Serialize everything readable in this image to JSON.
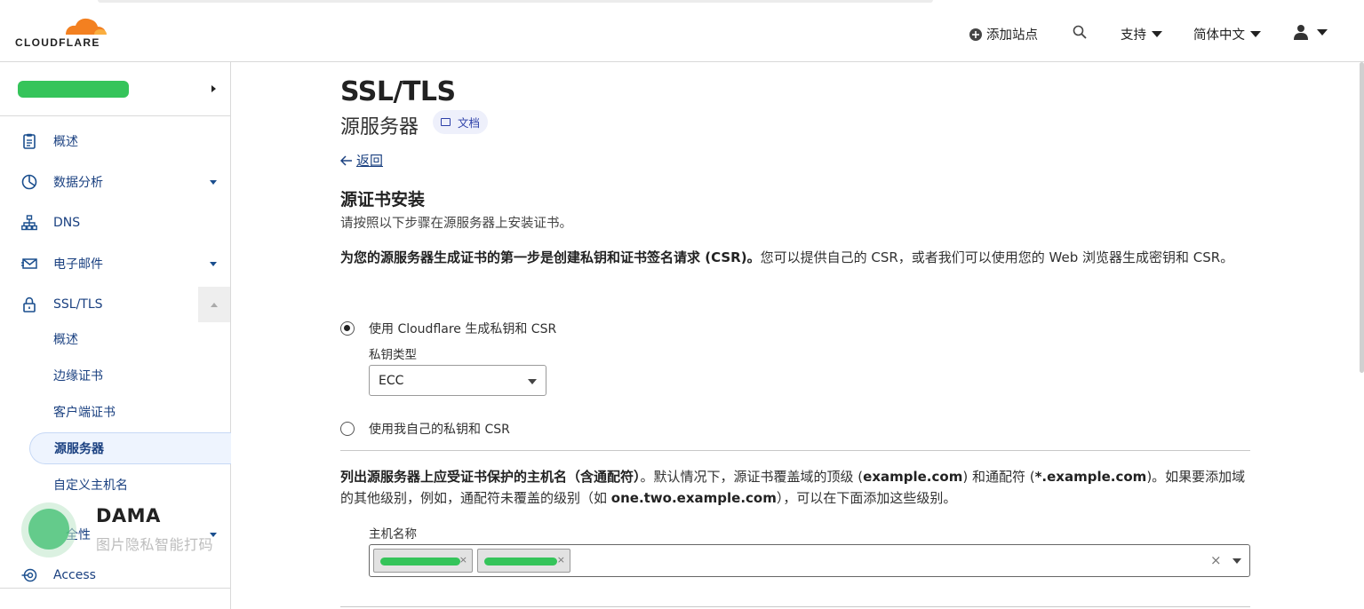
{
  "brand": {
    "wordmark": "CLOUDFLARE",
    "accent": "#f38020"
  },
  "topnav": {
    "add_site": "添加站点",
    "support": "支持",
    "language": "简体中文"
  },
  "sidebar": {
    "items": [
      {
        "label": "概述",
        "icon": "clipboard-icon"
      },
      {
        "label": "数据分析",
        "icon": "pie-chart-icon"
      },
      {
        "label": "DNS",
        "icon": "network-icon"
      },
      {
        "label": "电子邮件",
        "icon": "envelope-icon"
      },
      {
        "label": "SSL/TLS",
        "icon": "lock-icon"
      },
      {
        "label": "Access",
        "icon": "access-icon"
      }
    ],
    "ssl_sub": [
      {
        "label": "概述"
      },
      {
        "label": "边缘证书"
      },
      {
        "label": "客户端证书"
      },
      {
        "label": "源服务器"
      },
      {
        "label": "自定义主机名"
      }
    ],
    "partial_item": "全性"
  },
  "watermark": {
    "title": "DAMA",
    "subtitle": "图片隐私智能打码"
  },
  "page": {
    "title": "SSL/TLS",
    "subtitle": "源服务器",
    "docs": "文档",
    "back": "返回",
    "section_title": "源证书安装",
    "section_sub": "请按照以下步骤在源服务器上安装证书。",
    "csr_bold": "为您的源服务器生成证书的第一步是创建私钥和证书签名请求 (CSR)。",
    "csr_text": "您可以提供自己的 CSR，或者我们可以使用您的 Web 浏览器生成密钥和 CSR。",
    "option_cf": "使用 Cloudflare 生成私钥和 CSR",
    "key_type_label": "私钥类型",
    "key_type_value": "ECC",
    "option_own": "使用我自己的私钥和 CSR",
    "hosts_bold": "列出源服务器上应受证书保护的主机名（含通配符）",
    "hosts_t1": "。默认情况下，源证书覆盖域的顶级 (",
    "hosts_b1": "example.com",
    "hosts_t2": ") 和通配符 (",
    "hosts_b2": "*.example.com",
    "hosts_t3": ")。如果要添加域的其他级别，例如，通配符未覆盖的级别（如 ",
    "hosts_b3": "one.two.example.com",
    "hosts_t4": "），可以在下面添加这些级别。",
    "hostnames_label": "主机名称"
  }
}
